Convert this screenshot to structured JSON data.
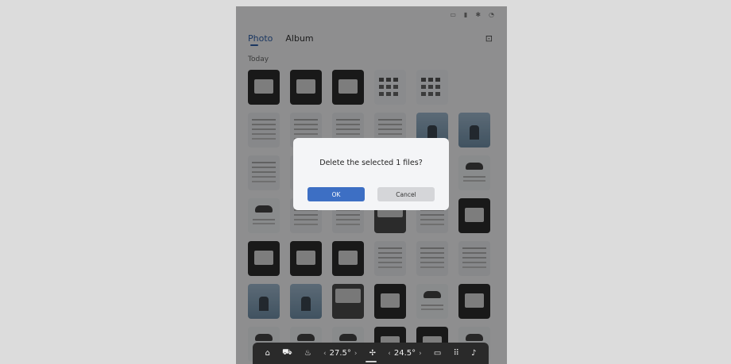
{
  "status_icons": [
    "battery-icon",
    "signal-icon",
    "bluetooth-icon",
    "wifi-icon"
  ],
  "tabs": [
    {
      "label": "Photo",
      "active": true
    },
    {
      "label": "Album",
      "active": false
    }
  ],
  "section_title": "Today",
  "thumbnails": [
    "dark",
    "dark",
    "dark",
    "grid-ui",
    "grid-ui",
    "blank",
    "light",
    "light",
    "light",
    "light",
    "sky",
    "sky",
    "light",
    "light",
    "light",
    "light",
    "light",
    "car",
    "car",
    "light",
    "light",
    "panel",
    "light",
    "dark",
    "dark",
    "dark",
    "dark",
    "light",
    "light",
    "light",
    "sky",
    "sky",
    "panel",
    "dark",
    "car",
    "dark",
    "car",
    "car",
    "car",
    "dark",
    "dark",
    "car"
  ],
  "dialog": {
    "message": "Delete the selected 1 files?",
    "ok_label": "OK",
    "cancel_label": "Cancel"
  },
  "dock": {
    "home_icon": "home-icon",
    "car_icon": "car-icon",
    "defrost_icon": "defrost-icon",
    "left_temp": "27.5°",
    "fan_icon": "fan-icon",
    "right_temp": "24.5°",
    "media_icon": "media-icon",
    "apps_icon": "apps-icon",
    "music_icon": "music-icon"
  }
}
